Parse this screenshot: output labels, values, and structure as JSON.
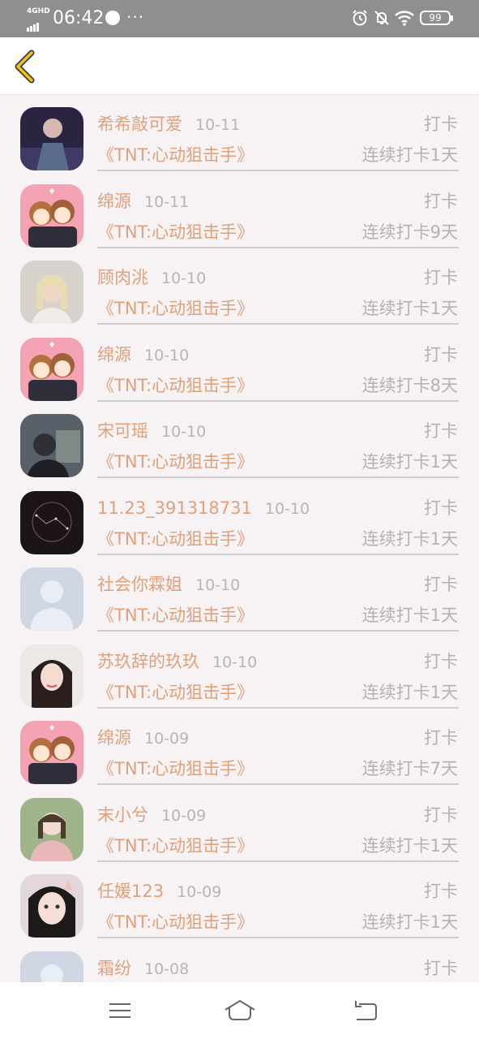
{
  "status_bar": {
    "network": "4GHD",
    "time": "06:42",
    "more": "···",
    "battery": "99"
  },
  "header": {
    "back_icon": "chevron-left-icon",
    "accent_color": "#f0c419"
  },
  "items": [
    {
      "name": "希希敲可爱",
      "date": "10-11",
      "action": "打卡",
      "book": "《TNT:心动狙击手》",
      "streak": "连续打卡1天",
      "avatar": "photo-dark"
    },
    {
      "name": "绵源",
      "date": "10-11",
      "action": "打卡",
      "book": "《TNT:心动狙击手》",
      "streak": "连续打卡9天",
      "avatar": "anime-pink"
    },
    {
      "name": "顾肉洮",
      "date": "10-10",
      "action": "打卡",
      "book": "《TNT:心动狙击手》",
      "streak": "连续打卡1天",
      "avatar": "photo-light"
    },
    {
      "name": "绵源",
      "date": "10-10",
      "action": "打卡",
      "book": "《TNT:心动狙击手》",
      "streak": "连续打卡8天",
      "avatar": "anime-pink"
    },
    {
      "name": "宋可瑶",
      "date": "10-10",
      "action": "打卡",
      "book": "《TNT:心动狙击手》",
      "streak": "连续打卡1天",
      "avatar": "photo-gray"
    },
    {
      "name": "11.23_391318731",
      "date": "10-10",
      "action": "打卡",
      "book": "《TNT:心动狙击手》",
      "streak": "连续打卡1天",
      "avatar": "photo-night"
    },
    {
      "name": "社会你霖姐",
      "date": "10-10",
      "action": "打卡",
      "book": "《TNT:心动狙击手》",
      "streak": "连续打卡1天",
      "avatar": "default"
    },
    {
      "name": "苏玖辞的玖玖",
      "date": "10-10",
      "action": "打卡",
      "book": "《TNT:心动狙击手》",
      "streak": "连续打卡1天",
      "avatar": "photo-girl"
    },
    {
      "name": "绵源",
      "date": "10-09",
      "action": "打卡",
      "book": "《TNT:心动狙击手》",
      "streak": "连续打卡7天",
      "avatar": "anime-pink"
    },
    {
      "name": "末小兮",
      "date": "10-09",
      "action": "打卡",
      "book": "《TNT:心动狙击手》",
      "streak": "连续打卡1天",
      "avatar": "photo-green"
    },
    {
      "name": "任媛123",
      "date": "10-09",
      "action": "打卡",
      "book": "《TNT:心动狙击手》",
      "streak": "连续打卡1天",
      "avatar": "photo-selfie"
    },
    {
      "name": "霜纷",
      "date": "10-08",
      "action": "打卡",
      "book": "",
      "streak": "",
      "avatar": "default"
    }
  ],
  "nav_bar": {
    "menu_icon": "menu-icon",
    "home_icon": "home-icon",
    "back_icon": "back-icon"
  }
}
